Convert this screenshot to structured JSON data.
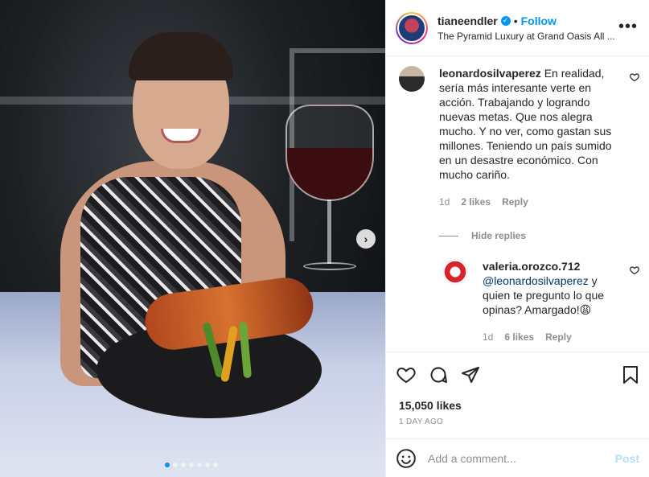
{
  "post": {
    "username": "tianeendler",
    "follow_label": "Follow",
    "location": "The Pyramid Luxury at Grand Oasis All ...",
    "more_icon": "more-options-icon",
    "carousel": {
      "slide_count": 7,
      "active_index": 0
    }
  },
  "comments": [
    {
      "username": "leonardosilvaperez",
      "text": "En realidad, sería más interesante verte en acción. Trabajando y logrando nuevas metas. Que nos alegra mucho. Y no ver, como gastan sus millones. Teniendo un país sumido en un desastre económico. Con mucho cariño.",
      "age": "1d",
      "likes": "2 likes",
      "reply_label": "Reply",
      "hide_replies_label": "Hide replies"
    }
  ],
  "replies": [
    {
      "username": "valeria.orozco.712",
      "mention": "@leonardosilvaperez",
      "text": " y quien te pregunto lo que opinas? Amargado!😩",
      "age": "1d",
      "likes": "6 likes",
      "reply_label": "Reply"
    }
  ],
  "footer": {
    "likes": "15,050 likes",
    "time": "1 DAY AGO",
    "comment_placeholder": "Add a comment...",
    "post_label": "Post"
  },
  "colors": {
    "accent": "#0095f6",
    "muted": "#8e8e8e",
    "text": "#262626",
    "post_disabled": "#b2dffc"
  }
}
